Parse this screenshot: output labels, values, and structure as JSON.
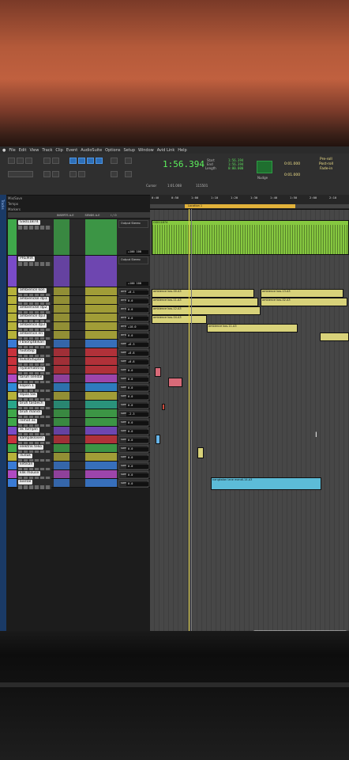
{
  "menu": [
    "File",
    "Edit",
    "View",
    "Track",
    "Clip",
    "Event",
    "AudioSuite",
    "Options",
    "Setup",
    "Window",
    "Avid Link",
    "Help"
  ],
  "counter": {
    "main": "1:56.394",
    "start_label": "Start",
    "end_label": "End",
    "length_label": "Length",
    "start": "1:56.394",
    "end": "1:56.394",
    "length": "0:00.000",
    "cursor_label": "Cursor",
    "cursor_value": "1:01.008",
    "nudge_label": "Nudge",
    "nudge_value": "0:01.000",
    "grid_value": "0:01.000",
    "preroll": "Pre-roll",
    "postroll": "Post-roll",
    "fadein": "Fade-in",
    "sample": "115501"
  },
  "left": {
    "strip_label": "Tracks",
    "mix": "Mix/Save",
    "tempo": "Tempo",
    "markers": "Markers",
    "col_headers": [
      "INSERTS A-E",
      "SENDS A-E",
      "I / O"
    ]
  },
  "ruler_ticks": [
    "0:40",
    "0:50",
    "1:00",
    "1:10",
    "1:20",
    "1:30",
    "1:40",
    "1:50",
    "2:00",
    "2:10"
  ],
  "location_label": "Location 1",
  "tracks": [
    {
      "name": "GS011874",
      "color": "#3fa84a",
      "h": 46,
      "io": "Output Stereo",
      "vol": "+100 100"
    },
    {
      "name": "PREMIX",
      "color": "#7a4bc8",
      "h": 40,
      "io": "Output Stereo",
      "vol": "+100 100"
    },
    {
      "name": "ambience kon",
      "color": "#b6b23a",
      "h": 11,
      "io": "ambience",
      "vol": "+0.1"
    },
    {
      "name": "ambiencke dp1",
      "color": "#b6b23a",
      "h": 11,
      "io": "ambience",
      "vol": "0.0"
    },
    {
      "name": "ambiencke dp2",
      "color": "#b6b23a",
      "h": 11,
      "io": "ambience",
      "vol": "0.0"
    },
    {
      "name": "ambience dp3",
      "color": "#b6b23a",
      "h": 11,
      "io": "ambience",
      "vol": "0.0"
    },
    {
      "name": "ambience dp3",
      "color": "#b6b23a",
      "h": 11,
      "io": "ambience",
      "vol": "+10.0"
    },
    {
      "name": "ambience eri",
      "color": "#b6b23a",
      "h": 11,
      "io": "ambience",
      "vol": "0.0"
    },
    {
      "name": "FbSonptBikan",
      "color": "#3a7bd5",
      "h": 11,
      "io": "sampai",
      "vol": "+6.3"
    },
    {
      "name": "footstep",
      "color": "#c8323c",
      "h": 11,
      "io": "sampai",
      "vol": "+0.8"
    },
    {
      "name": "bukatutupbri",
      "color": "#c8323c",
      "h": 11,
      "io": "sampai",
      "vol": "+0.8"
    },
    {
      "name": "nyalamatitng",
      "color": "#c8323c",
      "h": 11,
      "io": "sampai",
      "vol": "0.0"
    },
    {
      "name": "taruh sendal",
      "color": "#b14ac2",
      "h": 11,
      "io": "sampai",
      "vol": "0.0"
    },
    {
      "name": "kopen 1",
      "color": "#2f8ad8",
      "h": 11,
      "io": "sampai",
      "vol": "0.0"
    },
    {
      "name": "lepas tas",
      "color": "#b6b23a",
      "h": 11,
      "io": "sampai",
      "vol": "0.0"
    },
    {
      "name": "bruh tasbech",
      "color": "#2aa68a",
      "h": 11,
      "io": "sampai",
      "vol": "0.0"
    },
    {
      "name": "bruh mandi",
      "color": "#3fa84a",
      "h": 11,
      "io": "sampai",
      "vol": "-2.3"
    },
    {
      "name": "remot ac",
      "color": "#3fa84a",
      "h": 11,
      "io": "sampai",
      "vol": "0.0"
    },
    {
      "name": "ac turnjan",
      "color": "#7a4bc8",
      "h": 11,
      "io": "sampai",
      "vol": "0.0"
    },
    {
      "name": "kampaklosen",
      "color": "#c8323c",
      "h": 11,
      "io": "sampai",
      "vol": "0.0"
    },
    {
      "name": "elektrik teko",
      "color": "#3fa84a",
      "h": 11,
      "io": "sampai",
      "vol": "0.0"
    },
    {
      "name": "duduk",
      "color": "#b6b23a",
      "h": 11,
      "io": "sampai",
      "vol": "0.0"
    },
    {
      "name": "ketikan",
      "color": "#3a7bd5",
      "h": 11,
      "io": "sampai",
      "vol": "0.0"
    },
    {
      "name": "klik mouse",
      "color": "#b14ac2",
      "h": 11,
      "io": "sampai",
      "vol": "0.0"
    },
    {
      "name": "bantal",
      "color": "#3a7bd5",
      "h": 11,
      "io": "sampai",
      "vol": "0.0"
    }
  ],
  "clip_labels": {
    "main": "GS011874",
    "amb1": "ambience kos-00.A3",
    "amb2": "ambience kos-11.A3",
    "amb3": "ambience kos-13.A3",
    "amb4": "ambience kos-02.A3",
    "amb5": "ambience kos-12.A3",
    "amb6": "ambience kos-04.A3",
    "long": "nangkalan lane mandi-14.A3"
  }
}
